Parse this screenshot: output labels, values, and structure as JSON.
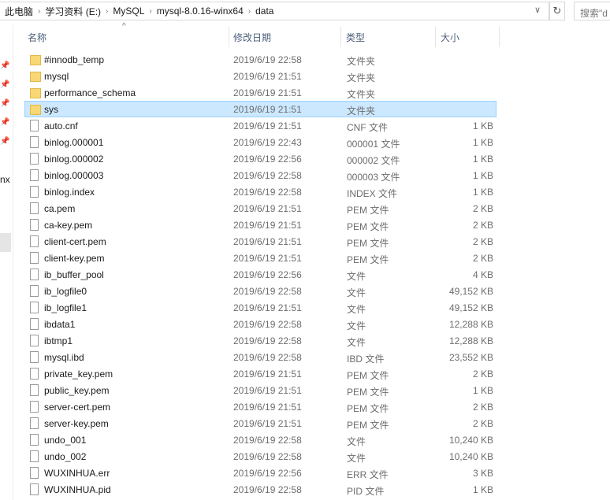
{
  "breadcrumb": [
    "此电脑",
    "学习资料 (E:)",
    "MySQL",
    "mysql-8.0.16-winx64",
    "data"
  ],
  "search_placeholder": "搜索\"d",
  "nav_partial_text": "nx",
  "columns": {
    "name": "名称",
    "date": "修改日期",
    "type": "类型",
    "size": "大小"
  },
  "files": [
    {
      "name": "#innodb_temp",
      "date": "2019/6/19 22:58",
      "type": "文件夹",
      "size": "",
      "kind": "folder"
    },
    {
      "name": "mysql",
      "date": "2019/6/19 21:51",
      "type": "文件夹",
      "size": "",
      "kind": "folder"
    },
    {
      "name": "performance_schema",
      "date": "2019/6/19 21:51",
      "type": "文件夹",
      "size": "",
      "kind": "folder"
    },
    {
      "name": "sys",
      "date": "2019/6/19 21:51",
      "type": "文件夹",
      "size": "",
      "kind": "folder",
      "selected": true
    },
    {
      "name": "auto.cnf",
      "date": "2019/6/19 21:51",
      "type": "CNF 文件",
      "size": "1 KB",
      "kind": "file"
    },
    {
      "name": "binlog.000001",
      "date": "2019/6/19 22:43",
      "type": "000001 文件",
      "size": "1 KB",
      "kind": "file"
    },
    {
      "name": "binlog.000002",
      "date": "2019/6/19 22:56",
      "type": "000002 文件",
      "size": "1 KB",
      "kind": "file"
    },
    {
      "name": "binlog.000003",
      "date": "2019/6/19 22:58",
      "type": "000003 文件",
      "size": "1 KB",
      "kind": "file"
    },
    {
      "name": "binlog.index",
      "date": "2019/6/19 22:58",
      "type": "INDEX 文件",
      "size": "1 KB",
      "kind": "file"
    },
    {
      "name": "ca.pem",
      "date": "2019/6/19 21:51",
      "type": "PEM 文件",
      "size": "2 KB",
      "kind": "file"
    },
    {
      "name": "ca-key.pem",
      "date": "2019/6/19 21:51",
      "type": "PEM 文件",
      "size": "2 KB",
      "kind": "file"
    },
    {
      "name": "client-cert.pem",
      "date": "2019/6/19 21:51",
      "type": "PEM 文件",
      "size": "2 KB",
      "kind": "file"
    },
    {
      "name": "client-key.pem",
      "date": "2019/6/19 21:51",
      "type": "PEM 文件",
      "size": "2 KB",
      "kind": "file"
    },
    {
      "name": "ib_buffer_pool",
      "date": "2019/6/19 22:56",
      "type": "文件",
      "size": "4 KB",
      "kind": "file"
    },
    {
      "name": "ib_logfile0",
      "date": "2019/6/19 22:58",
      "type": "文件",
      "size": "49,152 KB",
      "kind": "file"
    },
    {
      "name": "ib_logfile1",
      "date": "2019/6/19 21:51",
      "type": "文件",
      "size": "49,152 KB",
      "kind": "file"
    },
    {
      "name": "ibdata1",
      "date": "2019/6/19 22:58",
      "type": "文件",
      "size": "12,288 KB",
      "kind": "file"
    },
    {
      "name": "ibtmp1",
      "date": "2019/6/19 22:58",
      "type": "文件",
      "size": "12,288 KB",
      "kind": "file"
    },
    {
      "name": "mysql.ibd",
      "date": "2019/6/19 22:58",
      "type": "IBD 文件",
      "size": "23,552 KB",
      "kind": "file"
    },
    {
      "name": "private_key.pem",
      "date": "2019/6/19 21:51",
      "type": "PEM 文件",
      "size": "2 KB",
      "kind": "file"
    },
    {
      "name": "public_key.pem",
      "date": "2019/6/19 21:51",
      "type": "PEM 文件",
      "size": "1 KB",
      "kind": "file"
    },
    {
      "name": "server-cert.pem",
      "date": "2019/6/19 21:51",
      "type": "PEM 文件",
      "size": "2 KB",
      "kind": "file"
    },
    {
      "name": "server-key.pem",
      "date": "2019/6/19 21:51",
      "type": "PEM 文件",
      "size": "2 KB",
      "kind": "file"
    },
    {
      "name": "undo_001",
      "date": "2019/6/19 22:58",
      "type": "文件",
      "size": "10,240 KB",
      "kind": "file"
    },
    {
      "name": "undo_002",
      "date": "2019/6/19 22:58",
      "type": "文件",
      "size": "10,240 KB",
      "kind": "file"
    },
    {
      "name": "WUXINHUA.err",
      "date": "2019/6/19 22:56",
      "type": "ERR 文件",
      "size": "3 KB",
      "kind": "file"
    },
    {
      "name": "WUXINHUA.pid",
      "date": "2019/6/19 22:58",
      "type": "PID 文件",
      "size": "1 KB",
      "kind": "file"
    }
  ]
}
